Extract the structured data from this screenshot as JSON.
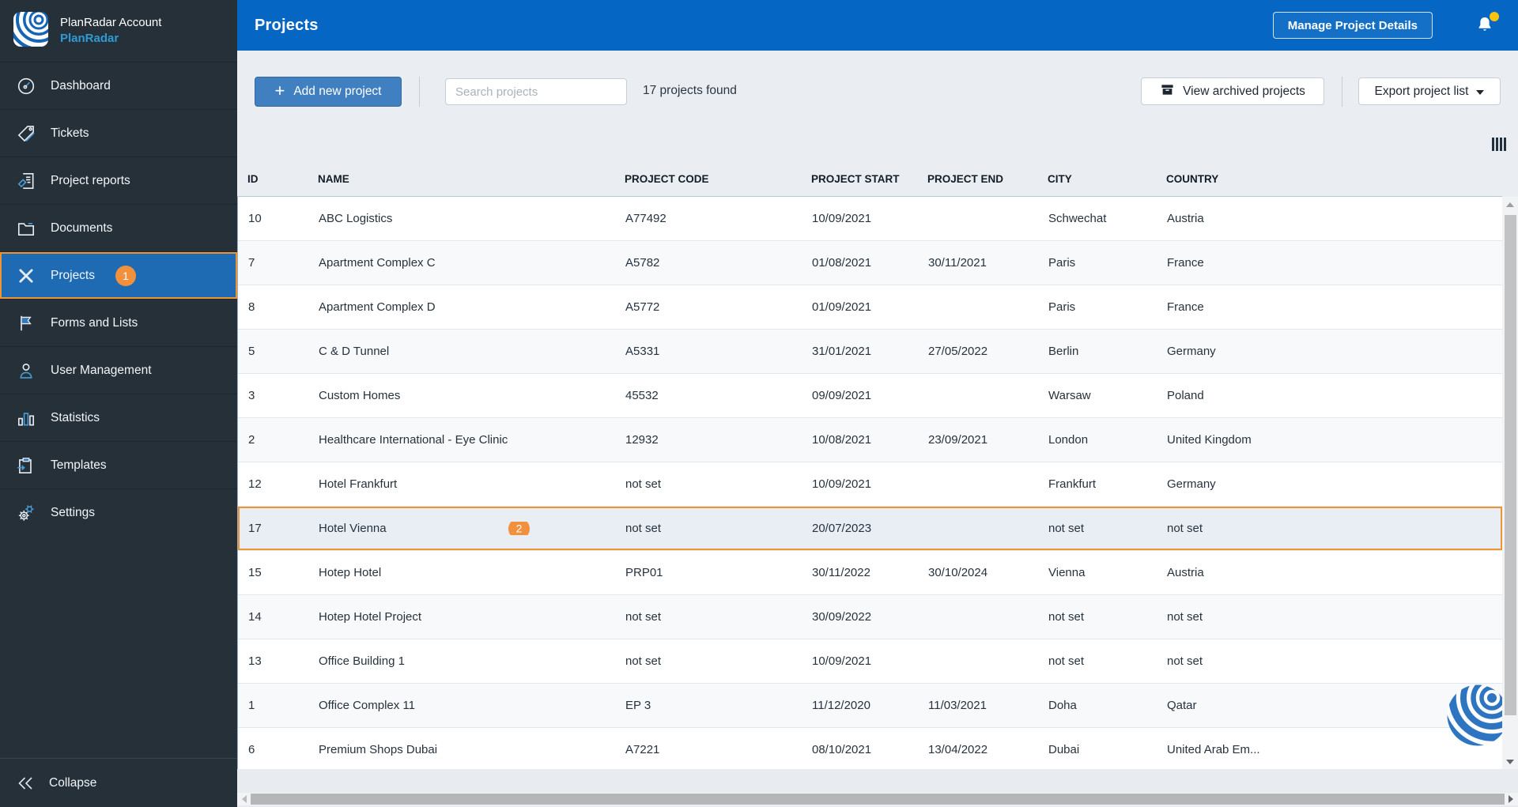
{
  "sidebar": {
    "account_label": "PlanRadar Account",
    "account_name": "PlanRadar",
    "items": [
      {
        "label": "Dashboard",
        "icon": "dashboard-icon"
      },
      {
        "label": "Tickets",
        "icon": "tickets-icon"
      },
      {
        "label": "Project reports",
        "icon": "project-reports-icon"
      },
      {
        "label": "Documents",
        "icon": "documents-icon"
      },
      {
        "label": "Projects",
        "icon": "projects-icon",
        "active": true,
        "badge": "1"
      },
      {
        "label": "Forms and Lists",
        "icon": "forms-and-lists-icon"
      },
      {
        "label": "User Management",
        "icon": "user-management-icon"
      },
      {
        "label": "Statistics",
        "icon": "statistics-icon"
      },
      {
        "label": "Templates",
        "icon": "templates-icon"
      },
      {
        "label": "Settings",
        "icon": "settings-icon"
      }
    ],
    "collapse_label": "Collapse"
  },
  "header": {
    "title": "Projects",
    "manage_button": "Manage Project Details",
    "notification_icon": "bell-icon",
    "notification_dot": true
  },
  "toolbar": {
    "add_button": "Add new project",
    "search_placeholder": "Search projects",
    "search_value": "",
    "results_count": "17 projects found",
    "view_archived_button": "View archived projects",
    "export_button": "Export project list"
  },
  "table": {
    "columns": [
      "ID",
      "NAME",
      "PROJECT CODE",
      "PROJECT START",
      "PROJECT END",
      "CITY",
      "COUNTRY"
    ],
    "rows": [
      {
        "id": "10",
        "name": "ABC Logistics",
        "code": "A77492",
        "start": "10/09/2021",
        "end": "",
        "city": "Schwechat",
        "country": "Austria"
      },
      {
        "id": "7",
        "name": "Apartment Complex C",
        "code": "A5782",
        "start": "01/08/2021",
        "end": "30/11/2021",
        "city": "Paris",
        "country": "France"
      },
      {
        "id": "8",
        "name": "Apartment Complex D",
        "code": "A5772",
        "start": "01/09/2021",
        "end": "",
        "city": "Paris",
        "country": "France"
      },
      {
        "id": "5",
        "name": "C & D Tunnel",
        "code": "A5331",
        "start": "31/01/2021",
        "end": "27/05/2022",
        "city": "Berlin",
        "country": "Germany"
      },
      {
        "id": "3",
        "name": "Custom Homes",
        "code": "45532",
        "start": "09/09/2021",
        "end": "",
        "city": "Warsaw",
        "country": "Poland"
      },
      {
        "id": "2",
        "name": "Healthcare International - Eye Clinic",
        "code": "12932",
        "start": "10/08/2021",
        "end": "23/09/2021",
        "city": "London",
        "country": "United Kingdom"
      },
      {
        "id": "12",
        "name": "Hotel Frankfurt",
        "code": "not set",
        "start": "10/09/2021",
        "end": "",
        "city": "Frankfurt",
        "country": "Germany"
      },
      {
        "id": "17",
        "name": "Hotel Vienna",
        "badge": "2",
        "selected": true,
        "code": "not set",
        "start": "20/07/2023",
        "end": "",
        "city": "not set",
        "country": "not set"
      },
      {
        "id": "15",
        "name": "Hotep Hotel",
        "code": "PRP01",
        "start": "30/11/2022",
        "end": "30/10/2024",
        "city": "Vienna",
        "country": "Austria"
      },
      {
        "id": "14",
        "name": "Hotep Hotel Project",
        "code": "not set",
        "start": "30/09/2022",
        "end": "",
        "city": "not set",
        "country": "not set"
      },
      {
        "id": "13",
        "name": "Office Building 1",
        "code": "not set",
        "start": "10/09/2021",
        "end": "",
        "city": "not set",
        "country": "not set"
      },
      {
        "id": "1",
        "name": "Office Complex 11",
        "code": "EP 3",
        "start": "11/12/2020",
        "end": "11/03/2021",
        "city": "Doha",
        "country": "Qatar"
      },
      {
        "id": "6",
        "name": "Premium Shops Dubai",
        "code": "A7221",
        "start": "08/10/2021",
        "end": "13/04/2022",
        "city": "Dubai",
        "country": "United Arab Em..."
      }
    ]
  },
  "colors": {
    "sidebar_bg": "#263039",
    "active_item_bg": "#1e6bb4",
    "active_item_border": "#ef9433",
    "topbar_bg": "#0666c4",
    "badge_orange": "#f2913d",
    "content_bg": "#eaeef2",
    "accent_blue": "#2e9bd6",
    "notification_dot": "#fcc40c",
    "selected_row_border": "#ee9430"
  }
}
